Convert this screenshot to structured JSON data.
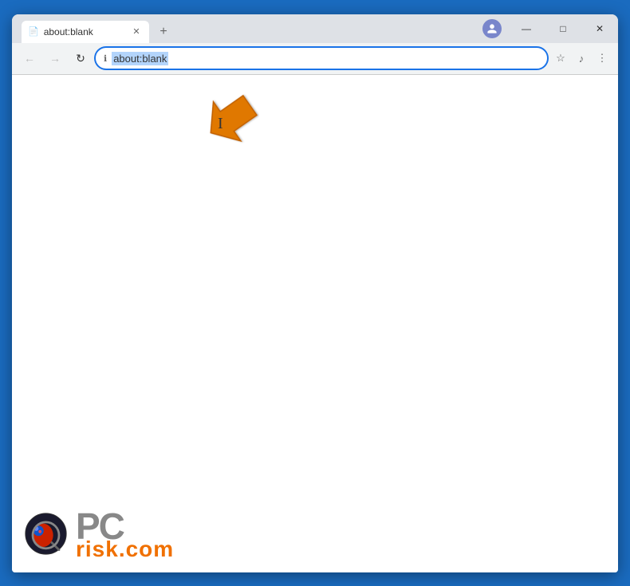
{
  "browser": {
    "title": "about:blank",
    "tab": {
      "label": "about:blank",
      "icon": "📄"
    },
    "address_bar": {
      "url": "about:blank",
      "selected": true
    },
    "nav": {
      "back_label": "←",
      "forward_label": "→",
      "reload_label": "↻",
      "bookmark_label": "☆",
      "music_label": "♪",
      "menu_label": "⋮"
    },
    "window_controls": {
      "minimize": "—",
      "maximize": "□",
      "close": "✕"
    }
  },
  "watermark": {
    "pc_text": "PC",
    "risk_text": "risk.com"
  },
  "arrow": {
    "color": "#e07800"
  }
}
